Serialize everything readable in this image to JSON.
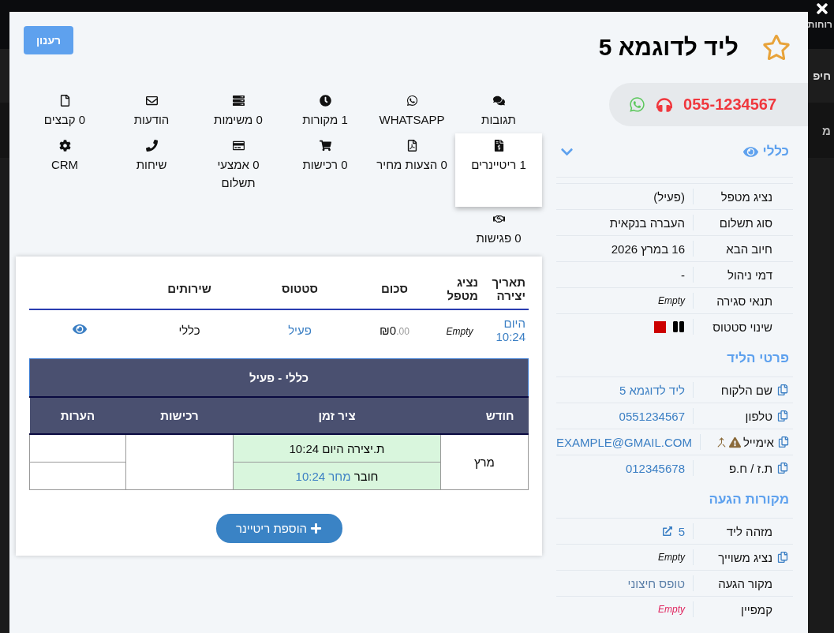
{
  "backdrop": {
    "texts": [
      "רוחות",
      "חיפ",
      "מ"
    ]
  },
  "header": {
    "title": "ליד לדוגמא 5",
    "starred": false,
    "refresh_button": "רענון"
  },
  "contact": {
    "phone": "055-1234567"
  },
  "tabs": [
    {
      "label": "תגובות",
      "selected": false
    },
    {
      "label": "WHATSAPP",
      "selected": false
    },
    {
      "label": "1 מקורות",
      "selected": false
    },
    {
      "label": "0 משימות",
      "selected": false
    },
    {
      "label": "הודעות",
      "selected": false
    },
    {
      "label": "0 קבצים",
      "selected": false
    },
    {
      "label": "1 ריטיינרים",
      "selected": true
    },
    {
      "label": "0 הצעות מחיר",
      "selected": false
    },
    {
      "label": "0 רכישות",
      "selected": false
    },
    {
      "label": "0 אמצעי תשלום",
      "selected": false
    },
    {
      "label": "שיחות",
      "selected": false
    },
    {
      "label": "CRM",
      "selected": false
    },
    {
      "label": "0 פגישות",
      "selected": false
    }
  ],
  "retainers": {
    "columns": [
      "תאריך יצירה",
      "נציג מטפל",
      "סכום",
      "סטטוס",
      "שירותים"
    ],
    "rows": [
      {
        "created": "היום 10:24",
        "agent": "Empty",
        "currency": "₪",
        "amount": "0",
        "decimals": ".00",
        "status": "פעיל",
        "services": "כללי"
      }
    ],
    "plan": {
      "title": "כללי - פעיל",
      "columns": [
        "חודש",
        "ציר זמן",
        "רכישות",
        "הערות"
      ],
      "months": [
        {
          "month": "מרץ",
          "timeline": [
            {
              "label": "ת.יצירה",
              "time": "היום 10:24",
              "linked": false
            },
            {
              "label": "חובר",
              "time": "מחר 10:24",
              "linked": true
            }
          ]
        }
      ]
    },
    "add_button": "הוספת ריטיינר"
  },
  "sections": [
    {
      "title": "כללי",
      "collapsible": true,
      "rows": [
        {
          "label": "נציג מטפל",
          "value": "(פעיל)",
          "kind": "text",
          "copyable": false
        },
        {
          "label": "סוג תשלום",
          "value": "העברה בנקאית",
          "kind": "text",
          "copyable": false
        },
        {
          "label": "חיוב הבא",
          "value": "16 במרץ 2026",
          "kind": "text",
          "copyable": false
        },
        {
          "label": "דמי ניהול",
          "value": "-",
          "kind": "text",
          "copyable": false
        },
        {
          "label": "תנאי סגירה",
          "value": "Empty",
          "kind": "empty",
          "copyable": false
        },
        {
          "label": "שינוי סטטוס",
          "kind": "status",
          "copyable": false
        }
      ]
    },
    {
      "title": "פרטי הליד",
      "collapsible": false,
      "rows": [
        {
          "label": "שם הלקוח",
          "value": "ליד לדוגמא 5",
          "kind": "link",
          "copyable": true
        },
        {
          "label": "טלפון",
          "value": "0551234567",
          "kind": "link",
          "copyable": true
        },
        {
          "label": "אימייל",
          "value": "EXAMPLE@GMAIL.COM",
          "kind": "link",
          "copyable": true,
          "warning": true
        },
        {
          "label": "ת.ז / ח.פ",
          "value": "012345678",
          "kind": "link",
          "copyable": true
        }
      ]
    },
    {
      "title": "מקורות הגעה",
      "collapsible": false,
      "rows": [
        {
          "label": "מזהה ליד",
          "value": "5",
          "kind": "external",
          "copyable": false
        },
        {
          "label": "נציג משוייך",
          "value": "Empty",
          "kind": "empty",
          "copyable": true
        },
        {
          "label": "מקור הגעה",
          "value": "טופס חיצוני",
          "kind": "muted",
          "copyable": false
        },
        {
          "label": "קמפיין",
          "value": "Empty",
          "kind": "alert",
          "copyable": false
        }
      ]
    }
  ]
}
